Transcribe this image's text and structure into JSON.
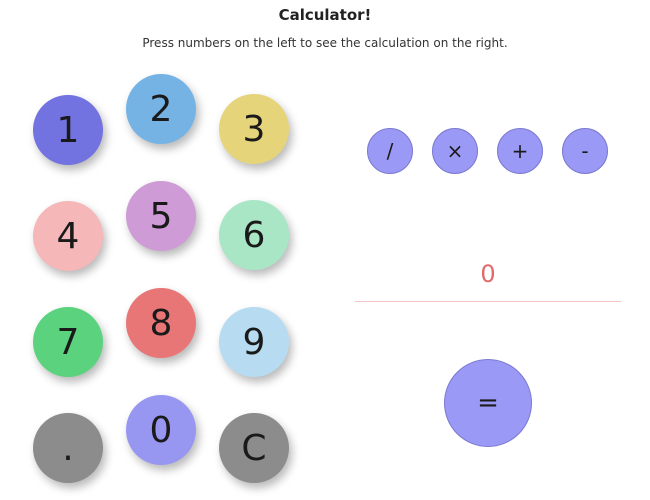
{
  "header": {
    "title": "Calculator!",
    "subtitle": "Press numbers on the left to see the calculation on the right."
  },
  "keypad": {
    "keys": [
      {
        "label": "1",
        "color": "#7272e0"
      },
      {
        "label": "2",
        "color": "#75b3e5"
      },
      {
        "label": "3",
        "color": "#e6d47a"
      },
      {
        "label": "4",
        "color": "#f5b7b7"
      },
      {
        "label": "5",
        "color": "#cf9bd6"
      },
      {
        "label": "6",
        "color": "#a9e6c6"
      },
      {
        "label": "7",
        "color": "#5bd27e"
      },
      {
        "label": "8",
        "color": "#e87676"
      },
      {
        "label": "9",
        "color": "#b7dcf1"
      },
      {
        "label": ".",
        "color": "#8c8c8c"
      },
      {
        "label": "0",
        "color": "#9797f2"
      },
      {
        "label": "C",
        "color": "#8c8c8c"
      }
    ]
  },
  "operators": {
    "divide": "/",
    "multiply": "×",
    "add": "+",
    "subtract": "-",
    "color": "#9a9af6"
  },
  "display": {
    "value": "0",
    "color": "#e06a6a"
  },
  "equals": {
    "label": "=",
    "color": "#9a9af6"
  }
}
